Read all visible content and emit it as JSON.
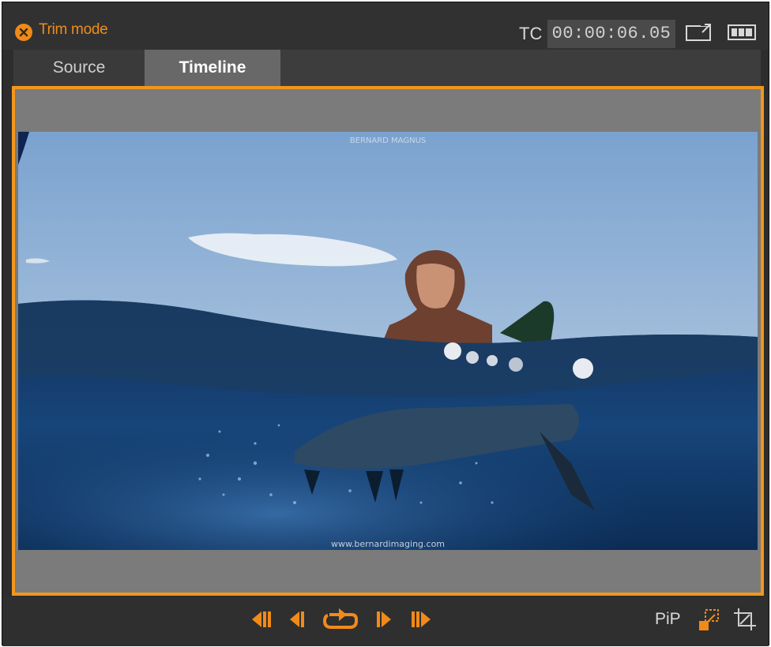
{
  "window": {
    "title": "Trim mode",
    "close_icon": "close-circle-icon",
    "accent_color": "#f2961e"
  },
  "timecode": {
    "label": "TC",
    "value": "00:00:06.05"
  },
  "header_icons": [
    "detach-window-icon",
    "display-mode-icon"
  ],
  "tabs": [
    {
      "label": "Source",
      "selected": false
    },
    {
      "label": "Timeline",
      "selected": true
    }
  ],
  "preview": {
    "top_watermark": "BERNARD MAGNUS",
    "bottom_watermark": "www.bernardimaging.com"
  },
  "transport": {
    "buttons": [
      "go-to-start-icon",
      "step-back-icon",
      "loop-play-icon",
      "step-forward-icon",
      "go-to-end-icon"
    ],
    "pip_label": "PiP",
    "pip_icon": "pip-toggle-icon",
    "crop_icon": "crop-icon"
  }
}
